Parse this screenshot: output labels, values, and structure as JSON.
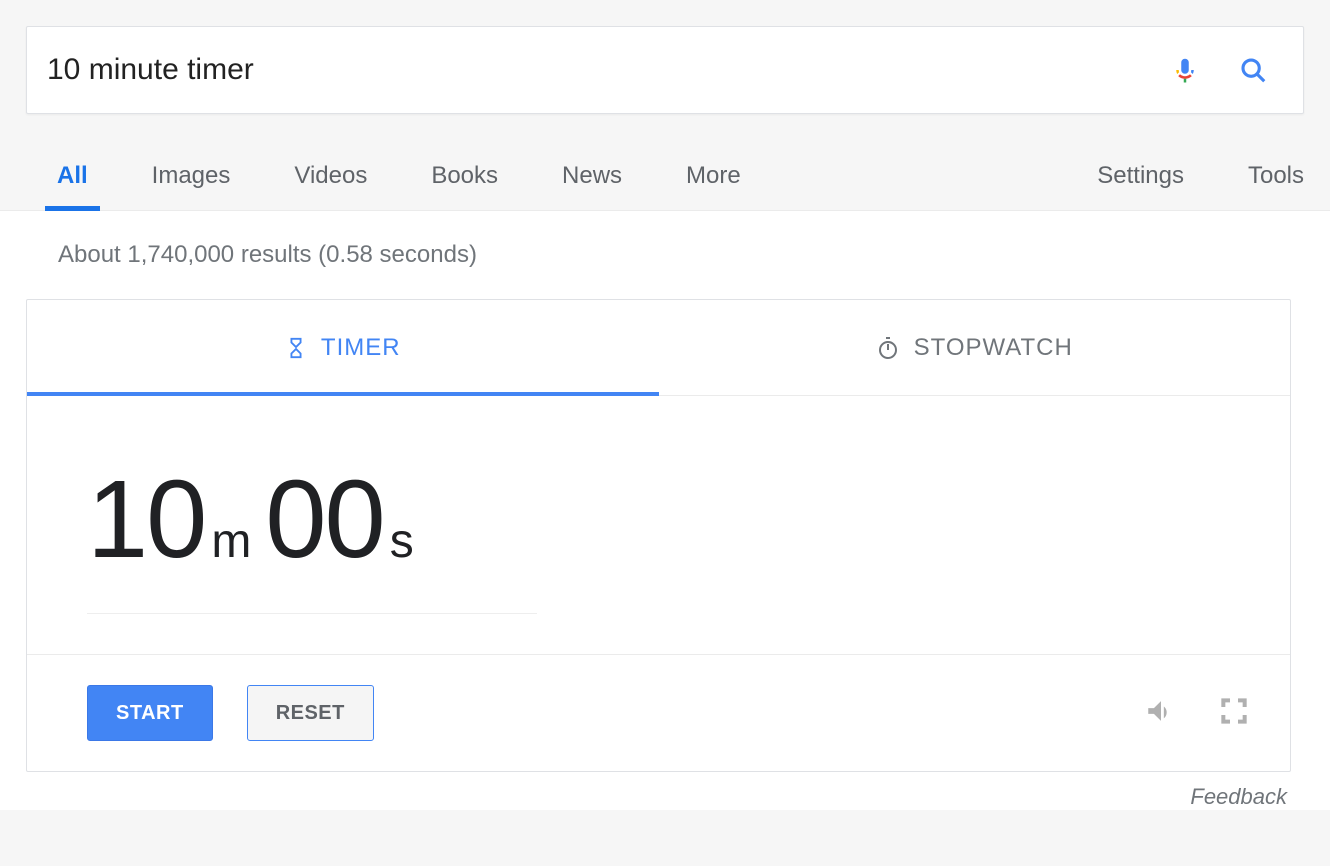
{
  "search": {
    "query": "10 minute timer"
  },
  "tabs": {
    "items": [
      "All",
      "Images",
      "Videos",
      "Books",
      "News",
      "More"
    ],
    "right": [
      "Settings",
      "Tools"
    ]
  },
  "resultStats": "About 1,740,000 results (0.58 seconds)",
  "widget": {
    "tabs": {
      "timer": "TIMER",
      "stopwatch": "STOPWATCH"
    },
    "time": {
      "minutes": "10",
      "minUnit": "m",
      "seconds": "00",
      "secUnit": "s"
    },
    "buttons": {
      "start": "START",
      "reset": "RESET"
    }
  },
  "feedback": "Feedback"
}
